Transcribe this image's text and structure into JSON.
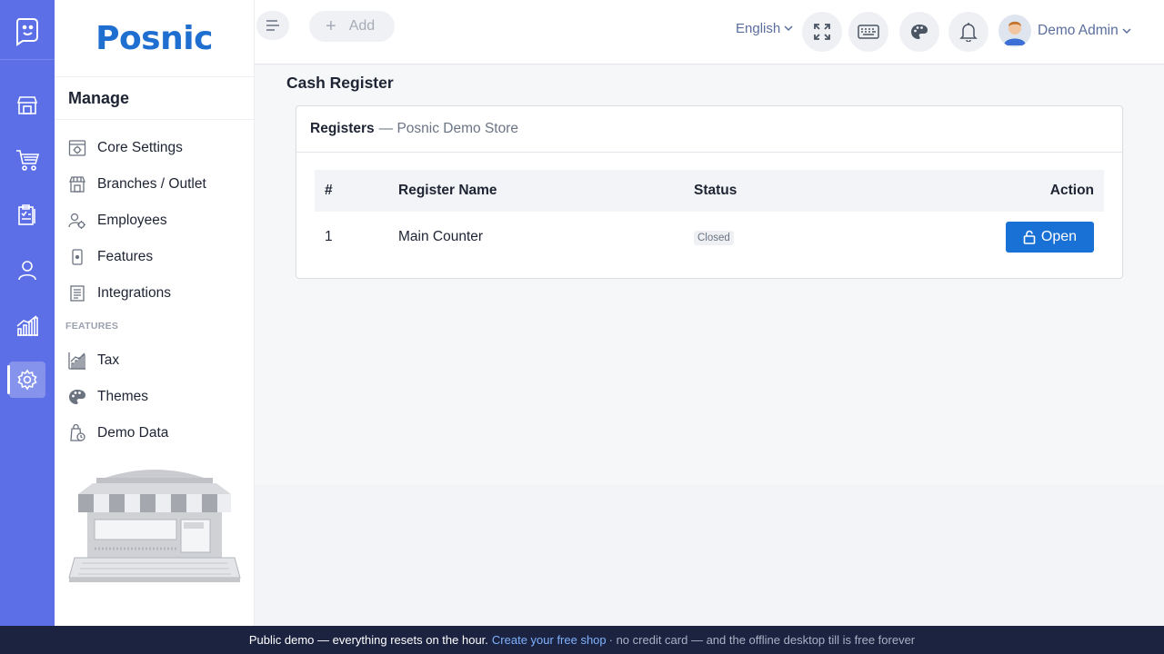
{
  "brand": {
    "name": "Posnic"
  },
  "sidebar": {
    "title": "Manage",
    "items": [
      {
        "label": "Core Settings",
        "icon": "settings-panel-icon"
      },
      {
        "label": "Branches / Outlet",
        "icon": "store-icon"
      },
      {
        "label": "Employees",
        "icon": "employees-icon"
      },
      {
        "label": "Features",
        "icon": "device-icon"
      },
      {
        "label": "Integrations",
        "icon": "integrations-icon"
      }
    ],
    "section_label": "FEATURES",
    "feature_items": [
      {
        "label": "Tax",
        "icon": "chart-icon"
      },
      {
        "label": "Themes",
        "icon": "palette-icon"
      },
      {
        "label": "Demo Data",
        "icon": "demo-data-icon"
      }
    ]
  },
  "topbar": {
    "add_label": "Add",
    "language": "English",
    "user_name": "Demo Admin"
  },
  "page": {
    "title": "Cash Register",
    "card_title": "Registers",
    "card_subtitle": "— Posnic Demo Store"
  },
  "table": {
    "headers": [
      "#",
      "Register Name",
      "Status",
      "Action"
    ],
    "rows": [
      {
        "num": "1",
        "name": "Main Counter",
        "status": "Closed",
        "action": "Open"
      }
    ]
  },
  "footer": {
    "text": "Public demo — everything resets on the hour.",
    "link": "Create your free shop",
    "rest": "· no credit card — and the offline desktop till is free forever"
  },
  "colors": {
    "rail": "#5c6fe6",
    "brand": "#1f6fd1",
    "primary_button": "#1971d6",
    "footer_bg": "#1c2340"
  }
}
